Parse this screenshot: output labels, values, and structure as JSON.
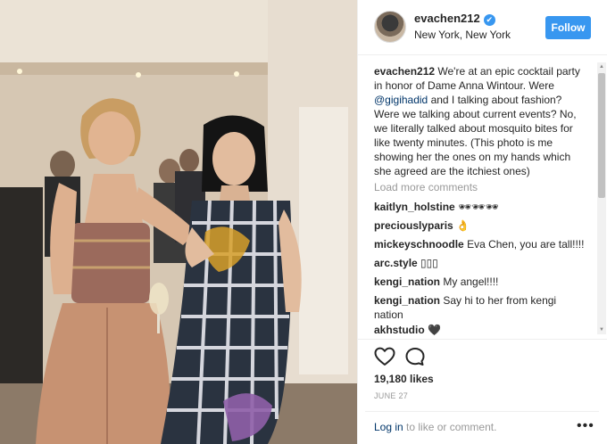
{
  "post": {
    "username": "evachen212",
    "location": "New York, New York",
    "follow_label": "Follow",
    "verified_mark": "✔"
  },
  "caption": {
    "username": "evachen212",
    "text_before_mention": " We're at an epic cocktail party in honor of Dame Anna Wintour. Were ",
    "mention": "@gigihadid",
    "text_after_mention": " and I talking about fashion? Were we talking about current events? No, we literally talked about mosquito bites for like twenty minutes. (This photo is me showing her the ones on my hands which she agreed are the itchiest ones)"
  },
  "load_more_label": "Load more comments",
  "comments": [
    {
      "user": "kaitlyn_holstine",
      "text": "🕶🕶🕶"
    },
    {
      "user": "preciouslyparis",
      "text": "👌"
    },
    {
      "user": "mickeyschnoodle",
      "text": "Eva Chen, you are tall!!!!"
    },
    {
      "user": "arc.style",
      "text": "▯▯▯"
    },
    {
      "user": "kengi_nation",
      "text": "My angel!!!!"
    },
    {
      "user": "kengi_nation",
      "text": "Say hi to her from kengi nation"
    },
    {
      "user": "akhstudio",
      "text": "🖤"
    }
  ],
  "likes_text": "19,180 likes",
  "date_text": "JUNE 27",
  "login": {
    "link": "Log in",
    "rest": " to like or comment."
  },
  "more_label": "•••",
  "scrollbar": {
    "up": "▲",
    "down": "▼"
  },
  "colors": {
    "accent": "#3897f0",
    "link": "#003569",
    "muted": "#999999"
  }
}
